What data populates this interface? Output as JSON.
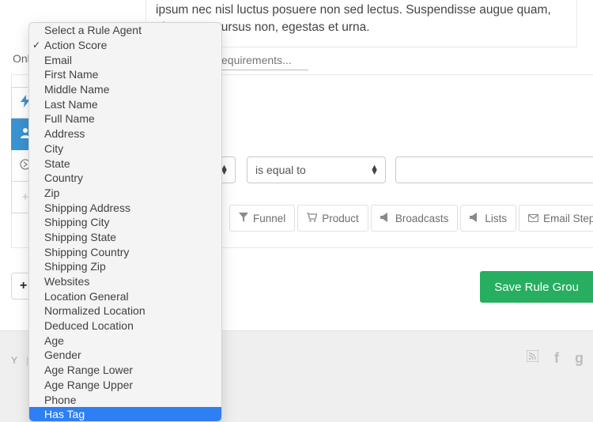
{
  "lorem": "ipsum nec nisl luctus posuere non sed lectus. Suspendisse augue quam, pharetra a cursus non, egestas et urna.",
  "only_label": "Only I",
  "requirements_placeholder": "equirements...",
  "hidden_select_caret_only": "",
  "operator_label": "is equal to",
  "chips": {
    "funnel": "Funnel",
    "product": "Product",
    "broadcasts": "Broadcasts",
    "lists": "Lists",
    "email_step": "Email Step"
  },
  "save_label": "Save Rule Grou",
  "footer_text": "Y",
  "dropdown": {
    "items": [
      "Select a Rule Agent",
      "Action Score",
      "Email",
      "First Name",
      "Middle Name",
      "Last Name",
      "Full Name",
      "Address",
      "City",
      "State",
      "Country",
      "Zip",
      "Shipping Address",
      "Shipping City",
      "Shipping State",
      "Shipping Country",
      "Shipping Zip",
      "Websites",
      "Location General",
      "Normalized Location",
      "Deduced Location",
      "Age",
      "Gender",
      "Age Range Lower",
      "Age Range Upper",
      "Phone",
      "Has Tag"
    ],
    "checked_index": 1,
    "highlighted_index": 26
  }
}
